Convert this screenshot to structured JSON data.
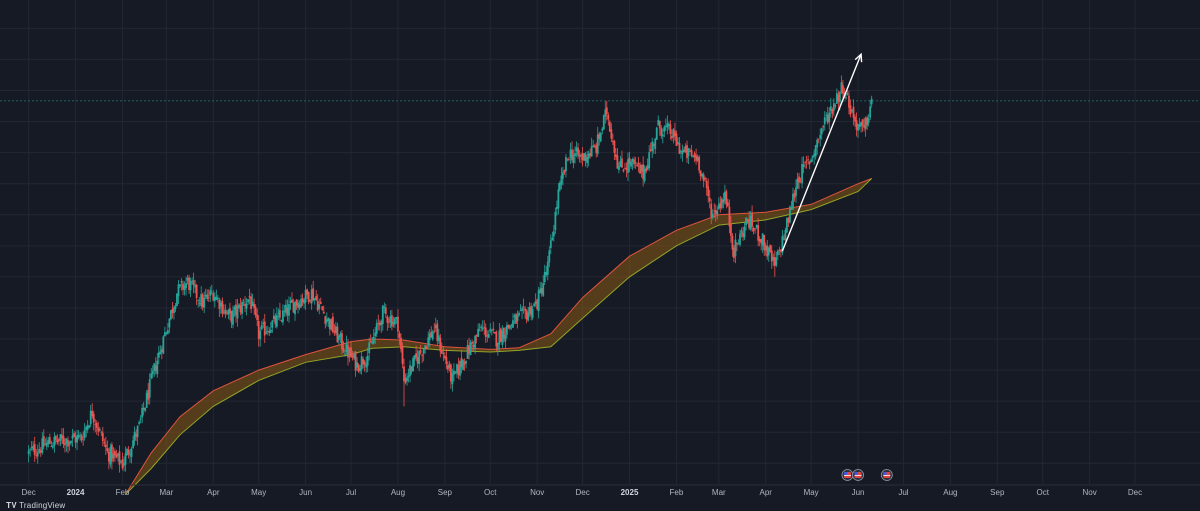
{
  "branding": {
    "logo_text": "TradingView"
  },
  "colors": {
    "background": "#161a25",
    "grid": "#232733",
    "up": "#26a69a",
    "down": "#ef5350",
    "fast_ma": "#e0533c",
    "slow_ma": "#93a528",
    "band_fill": "#8a5a14",
    "arrow": "#ffffff",
    "price_line": "#26a69a"
  },
  "chart_data": {
    "type": "candlestick",
    "title": "",
    "x_tick_labels": [
      {
        "month": "2023-12",
        "label": "Dec",
        "bold": false
      },
      {
        "month": "2024-01",
        "label": "2024",
        "bold": true
      },
      {
        "month": "2024-02",
        "label": "Feb",
        "bold": false
      },
      {
        "month": "2024-03",
        "label": "Mar",
        "bold": false
      },
      {
        "month": "2024-04",
        "label": "Apr",
        "bold": false
      },
      {
        "month": "2024-05",
        "label": "May",
        "bold": false
      },
      {
        "month": "2024-06",
        "label": "Jun",
        "bold": false
      },
      {
        "month": "2024-07",
        "label": "Jul",
        "bold": false
      },
      {
        "month": "2024-08",
        "label": "Aug",
        "bold": false
      },
      {
        "month": "2024-09",
        "label": "Sep",
        "bold": false
      },
      {
        "month": "2024-10",
        "label": "Oct",
        "bold": false
      },
      {
        "month": "2024-11",
        "label": "Nov",
        "bold": false
      },
      {
        "month": "2024-12",
        "label": "Dec",
        "bold": false
      },
      {
        "month": "2025-01",
        "label": "2025",
        "bold": true
      },
      {
        "month": "2025-02",
        "label": "Feb",
        "bold": false
      },
      {
        "month": "2025-03",
        "label": "Mar",
        "bold": false
      },
      {
        "month": "2025-04",
        "label": "Apr",
        "bold": false
      },
      {
        "month": "2025-05",
        "label": "May",
        "bold": false
      },
      {
        "month": "2025-06",
        "label": "Jun",
        "bold": false
      },
      {
        "month": "2025-07",
        "label": "Jul",
        "bold": false
      },
      {
        "month": "2025-08",
        "label": "Aug",
        "bold": false
      },
      {
        "month": "2025-09",
        "label": "Sep",
        "bold": false
      },
      {
        "month": "2025-10",
        "label": "Oct",
        "bold": false
      },
      {
        "month": "2025-11",
        "label": "Nov",
        "bold": false
      },
      {
        "month": "2025-12",
        "label": "Dec",
        "bold": false
      }
    ],
    "x_range": [
      "2023-11-20",
      "2026-01-05"
    ],
    "price_path": [
      [
        "2023-12-01",
        40
      ],
      [
        "2023-12-15",
        42
      ],
      [
        "2024-01-05",
        43
      ],
      [
        "2024-01-12",
        48
      ],
      [
        "2024-01-22",
        40
      ],
      [
        "2024-02-01",
        38
      ],
      [
        "2024-02-12",
        45
      ],
      [
        "2024-02-22",
        56
      ],
      [
        "2024-03-01",
        64
      ],
      [
        "2024-03-08",
        71
      ],
      [
        "2024-03-15",
        73
      ],
      [
        "2024-03-25",
        69
      ],
      [
        "2024-04-01",
        71
      ],
      [
        "2024-04-12",
        66
      ],
      [
        "2024-04-25",
        70
      ],
      [
        "2024-05-01",
        63
      ],
      [
        "2024-05-15",
        66
      ],
      [
        "2024-05-25",
        69
      ],
      [
        "2024-06-05",
        71
      ],
      [
        "2024-06-15",
        66
      ],
      [
        "2024-06-25",
        61
      ],
      [
        "2024-07-05",
        57
      ],
      [
        "2024-07-12",
        59
      ],
      [
        "2024-07-22",
        67
      ],
      [
        "2024-08-01",
        65
      ],
      [
        "2024-08-05",
        54
      ],
      [
        "2024-08-15",
        59
      ],
      [
        "2024-08-25",
        64
      ],
      [
        "2024-09-06",
        54
      ],
      [
        "2024-09-15",
        59
      ],
      [
        "2024-09-25",
        64
      ],
      [
        "2024-10-05",
        62
      ],
      [
        "2024-10-15",
        65
      ],
      [
        "2024-10-25",
        67
      ],
      [
        "2024-11-01",
        69
      ],
      [
        "2024-11-08",
        76
      ],
      [
        "2024-11-15",
        90
      ],
      [
        "2024-11-22",
        98
      ],
      [
        "2024-12-01",
        97
      ],
      [
        "2024-12-10",
        99
      ],
      [
        "2024-12-17",
        106
      ],
      [
        "2024-12-25",
        95
      ],
      [
        "2025-01-01",
        96
      ],
      [
        "2025-01-10",
        94
      ],
      [
        "2025-01-20",
        103
      ],
      [
        "2025-01-28",
        102
      ],
      [
        "2025-02-05",
        98
      ],
      [
        "2025-02-15",
        97
      ],
      [
        "2025-02-25",
        86
      ],
      [
        "2025-03-05",
        90
      ],
      [
        "2025-03-11",
        79
      ],
      [
        "2025-03-20",
        85
      ],
      [
        "2025-03-28",
        82
      ],
      [
        "2025-04-07",
        76
      ],
      [
        "2025-04-15",
        84
      ],
      [
        "2025-04-22",
        93
      ],
      [
        "2025-05-01",
        97
      ],
      [
        "2025-05-10",
        104
      ],
      [
        "2025-05-22",
        111
      ],
      [
        "2025-05-30",
        104
      ],
      [
        "2025-06-05",
        102
      ],
      [
        "2025-06-10",
        108
      ]
    ],
    "wick_extremes": [
      {
        "date": "2024-08-05",
        "low": 49
      },
      {
        "date": "2024-03-14",
        "high": 74
      },
      {
        "date": "2024-12-17",
        "high": 108
      },
      {
        "date": "2025-04-07",
        "low": 74
      },
      {
        "date": "2025-05-22",
        "high": 112
      }
    ],
    "last_price": 108,
    "series": [
      {
        "style": "line",
        "values": [
          [
            "2024-02-03",
            32
          ],
          [
            "2024-02-20",
            40
          ],
          [
            "2024-03-10",
            47
          ],
          [
            "2024-04-01",
            52
          ],
          [
            "2024-05-01",
            56
          ],
          [
            "2024-06-01",
            59
          ],
          [
            "2024-07-01",
            61.5
          ],
          [
            "2024-07-15",
            62
          ],
          [
            "2024-08-05",
            61.8
          ],
          [
            "2024-09-01",
            60.5
          ],
          [
            "2024-10-01",
            60
          ],
          [
            "2024-10-20",
            60.3
          ],
          [
            "2024-11-10",
            63
          ],
          [
            "2024-12-01",
            70
          ],
          [
            "2025-01-01",
            78
          ],
          [
            "2025-02-01",
            83
          ],
          [
            "2025-03-01",
            86
          ],
          [
            "2025-04-01",
            86.5
          ],
          [
            "2025-05-01",
            88
          ],
          [
            "2025-06-01",
            92
          ],
          [
            "2025-06-10",
            93
          ]
        ]
      },
      {
        "style": "line",
        "values": [
          [
            "2024-02-03",
            32
          ],
          [
            "2024-02-20",
            37
          ],
          [
            "2024-03-10",
            43.5
          ],
          [
            "2024-04-01",
            49
          ],
          [
            "2024-05-01",
            54
          ],
          [
            "2024-06-01",
            57.5
          ],
          [
            "2024-07-01",
            59
          ],
          [
            "2024-07-15",
            60.2
          ],
          [
            "2024-08-05",
            60.5
          ],
          [
            "2024-09-01",
            59.8
          ],
          [
            "2024-10-01",
            59.5
          ],
          [
            "2024-10-20",
            59.8
          ],
          [
            "2024-11-10",
            60.5
          ],
          [
            "2024-12-01",
            66
          ],
          [
            "2025-01-01",
            74
          ],
          [
            "2025-02-01",
            80
          ],
          [
            "2025-03-01",
            84
          ],
          [
            "2025-04-01",
            85
          ],
          [
            "2025-05-01",
            87
          ],
          [
            "2025-06-01",
            90.5
          ],
          [
            "2025-06-10",
            93
          ]
        ]
      }
    ],
    "trend_arrow": {
      "from": [
        "2025-04-12",
        79
      ],
      "to": [
        "2025-06-03",
        117
      ]
    },
    "event_markers": [
      {
        "date": "2025-05-25",
        "icon": "us-flag-icon"
      },
      {
        "date": "2025-06-01",
        "icon": "us-flag-icon"
      },
      {
        "date": "2025-06-20",
        "icon": "us-flag-icon"
      }
    ],
    "grid": true,
    "y_range": [
      34,
      124
    ]
  }
}
